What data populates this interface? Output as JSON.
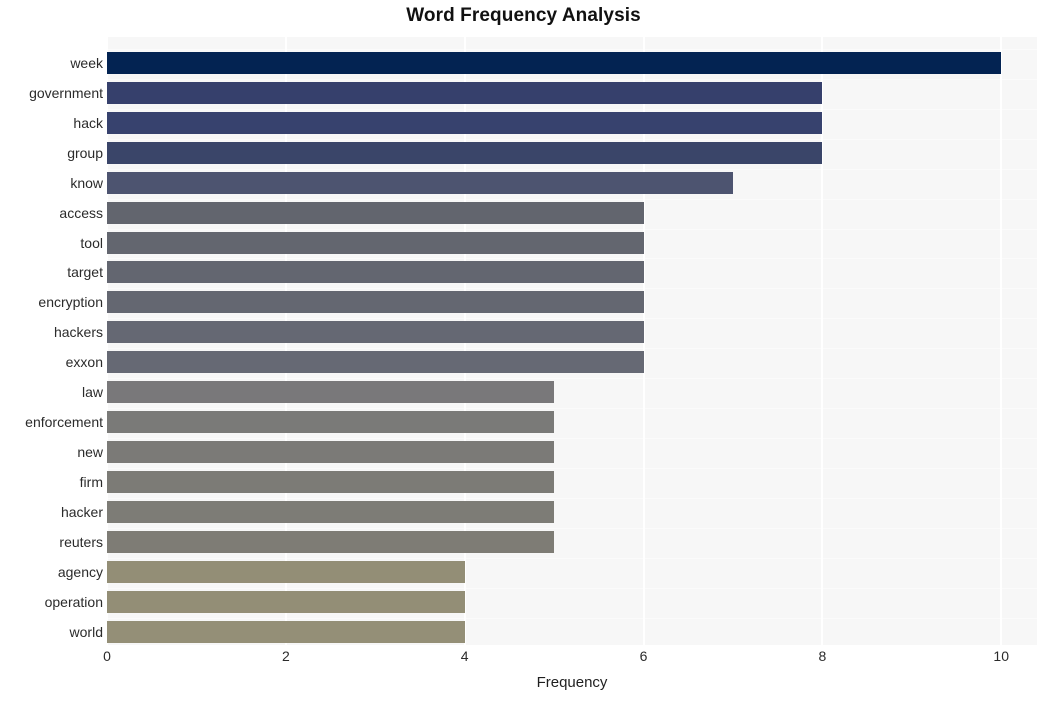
{
  "chart_data": {
    "type": "bar",
    "orientation": "horizontal",
    "title": "Word Frequency Analysis",
    "xlabel": "Frequency",
    "ylabel": "",
    "xlim": [
      0,
      10.4
    ],
    "xticks": [
      0,
      2,
      4,
      6,
      8,
      10
    ],
    "xtick_labels": [
      "0",
      "2",
      "4",
      "6",
      "8",
      "10"
    ],
    "grid": true,
    "grid_axis": "both",
    "legend": false,
    "background": "#f7f7f7",
    "categories": [
      "week",
      "government",
      "hack",
      "group",
      "know",
      "access",
      "tool",
      "target",
      "encryption",
      "hackers",
      "exxon",
      "law",
      "enforcement",
      "new",
      "firm",
      "hacker",
      "reuters",
      "agency",
      "operation",
      "world"
    ],
    "values": [
      10,
      8,
      8,
      8,
      7,
      6,
      6,
      6,
      6,
      6,
      6,
      5,
      5,
      5,
      5,
      5,
      5,
      4,
      4,
      4
    ],
    "bar_colors": [
      "#032352",
      "#36406c",
      "#37426e",
      "#3a4569",
      "#4d5470",
      "#62656e",
      "#63666f",
      "#636670",
      "#646771",
      "#656873",
      "#666974",
      "#79787a",
      "#7a7a78",
      "#7b7a77",
      "#7c7b76",
      "#7d7c76",
      "#7e7c75",
      "#938e76",
      "#938e76",
      "#948f77"
    ]
  }
}
